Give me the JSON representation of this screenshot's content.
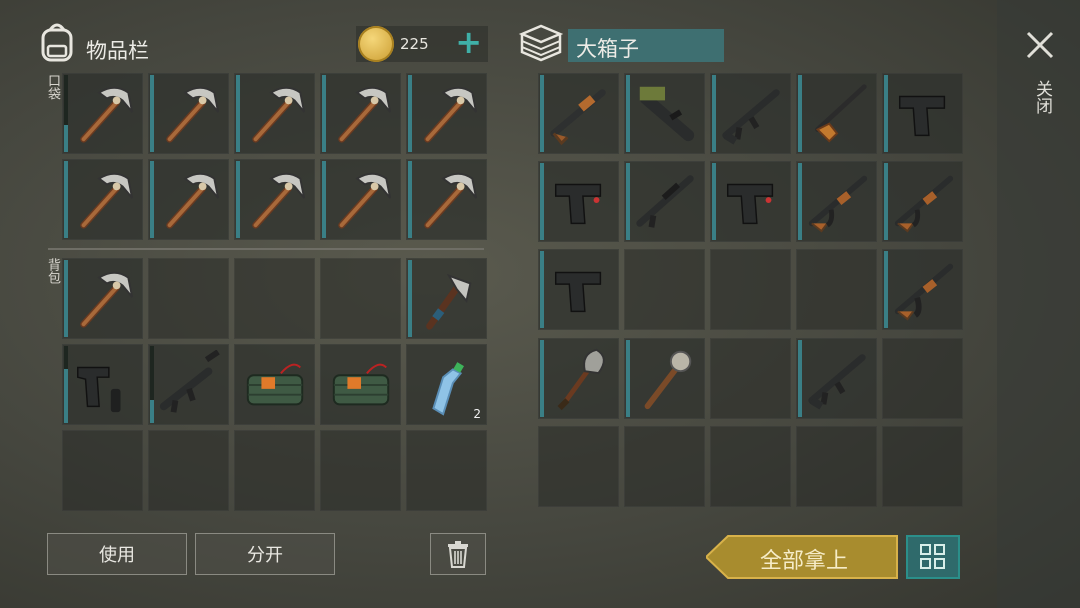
{
  "inventory": {
    "title": "物品栏",
    "coins": "225",
    "pocket_label": "口袋",
    "backpack_label": "背包",
    "pocket_slots": [
      {
        "icon": "pickaxe-icon",
        "durability": 0.35
      },
      {
        "icon": "pickaxe-icon",
        "durability": 1
      },
      {
        "icon": "pickaxe-icon",
        "durability": 1
      },
      {
        "icon": "pickaxe-icon",
        "durability": 1
      },
      {
        "icon": "pickaxe-icon",
        "durability": 1
      },
      {
        "icon": "pickaxe-icon",
        "durability": 1
      },
      {
        "icon": "pickaxe-icon",
        "durability": 1
      },
      {
        "icon": "pickaxe-icon",
        "durability": 1
      },
      {
        "icon": "pickaxe-icon",
        "durability": 1
      },
      {
        "icon": "pickaxe-icon",
        "durability": 1
      }
    ],
    "backpack_slots": [
      {
        "icon": "pickaxe-icon",
        "durability": 1
      },
      {
        "icon": ""
      },
      {
        "icon": ""
      },
      {
        "icon": ""
      },
      {
        "icon": "hatchet-icon",
        "durability": 1
      },
      {
        "icon": "pistol-silencer-icon",
        "durability": 0.7
      },
      {
        "icon": "rifle-silencer-icon",
        "durability": 0.3
      },
      {
        "icon": "explosive-icon"
      },
      {
        "icon": "explosive-icon"
      },
      {
        "icon": "water-bottle-icon",
        "count": "2"
      },
      {
        "icon": ""
      },
      {
        "icon": ""
      },
      {
        "icon": ""
      },
      {
        "icon": ""
      },
      {
        "icon": ""
      }
    ],
    "use_label": "使用",
    "split_label": "分开"
  },
  "box": {
    "title": "大箱子",
    "slots": [
      {
        "icon": "shotgun-icon",
        "durability": 1
      },
      {
        "icon": "grenade-launcher-icon",
        "durability": 1
      },
      {
        "icon": "assault-rifle-icon",
        "durability": 1
      },
      {
        "icon": "hunting-rifle-icon",
        "durability": 1
      },
      {
        "icon": "pistol-icon",
        "durability": 1
      },
      {
        "icon": "pistol-laser-icon",
        "durability": 1
      },
      {
        "icon": "rifle-scope-icon",
        "durability": 1
      },
      {
        "icon": "pistol-laser-icon",
        "durability": 1
      },
      {
        "icon": "ak-icon",
        "durability": 1
      },
      {
        "icon": "ak-icon",
        "durability": 1
      },
      {
        "icon": "pistol-icon",
        "durability": 1
      },
      {
        "icon": ""
      },
      {
        "icon": ""
      },
      {
        "icon": ""
      },
      {
        "icon": "ak-mag-icon",
        "durability": 1
      },
      {
        "icon": "shovel-icon",
        "durability": 1
      },
      {
        "icon": "torch-icon",
        "durability": 1
      },
      {
        "icon": ""
      },
      {
        "icon": "assault-rifle-icon",
        "durability": 1
      },
      {
        "icon": ""
      },
      {
        "icon": ""
      },
      {
        "icon": ""
      },
      {
        "icon": ""
      },
      {
        "icon": ""
      },
      {
        "icon": ""
      }
    ],
    "take_all_label": "全部拿上"
  },
  "close_label": "关闭",
  "colors": {
    "accent_teal": "#3a7f86",
    "gold": "#d8b24a",
    "take_all_bg": "#a88c2e"
  }
}
